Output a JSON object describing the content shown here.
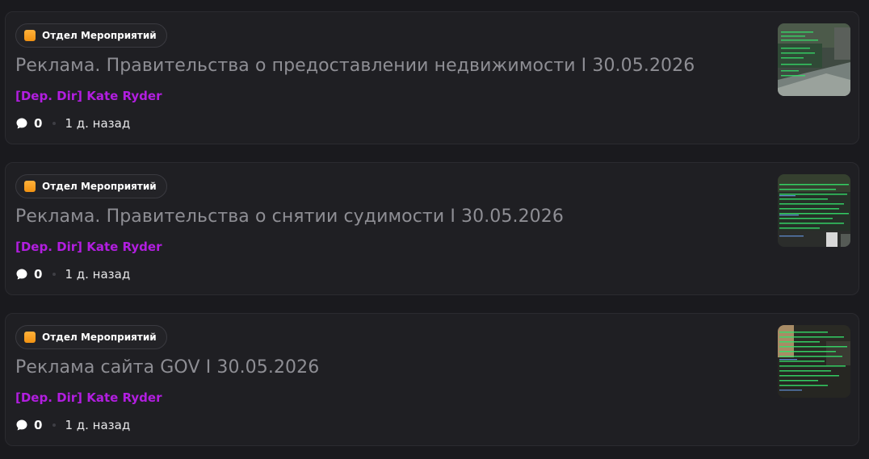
{
  "posts": [
    {
      "tag": {
        "label": "Отдел Мероприятий",
        "icon": "orange-square-icon"
      },
      "title": "Реклама. Правительства о предоставлении недвижимости I 30.05.2026",
      "author": "[Dep. Dir] Kate Ryder",
      "comments": "0",
      "time": "1 д. назад",
      "thumbnail": "screenshot-thumbnail"
    },
    {
      "tag": {
        "label": "Отдел Мероприятий",
        "icon": "orange-square-icon"
      },
      "title": "Реклама. Правительства о снятии судимости I 30.05.2026",
      "author": "[Dep. Dir] Kate Ryder",
      "comments": "0",
      "time": "1 д. назад",
      "thumbnail": "screenshot-thumbnail"
    },
    {
      "tag": {
        "label": "Отдел Мероприятий",
        "icon": "orange-square-icon"
      },
      "title": "Реклама сайта GOV I 30.05.2026",
      "author": "[Dep. Dir] Kate Ryder",
      "comments": "0",
      "time": "1 д. назад",
      "thumbnail": "screenshot-thumbnail"
    }
  ],
  "colors": {
    "background": "#1a1a1e",
    "card": "#1f1f23",
    "title": "#8e8e94",
    "author": "#b21ee0",
    "tag_icon": "#f5a020"
  }
}
